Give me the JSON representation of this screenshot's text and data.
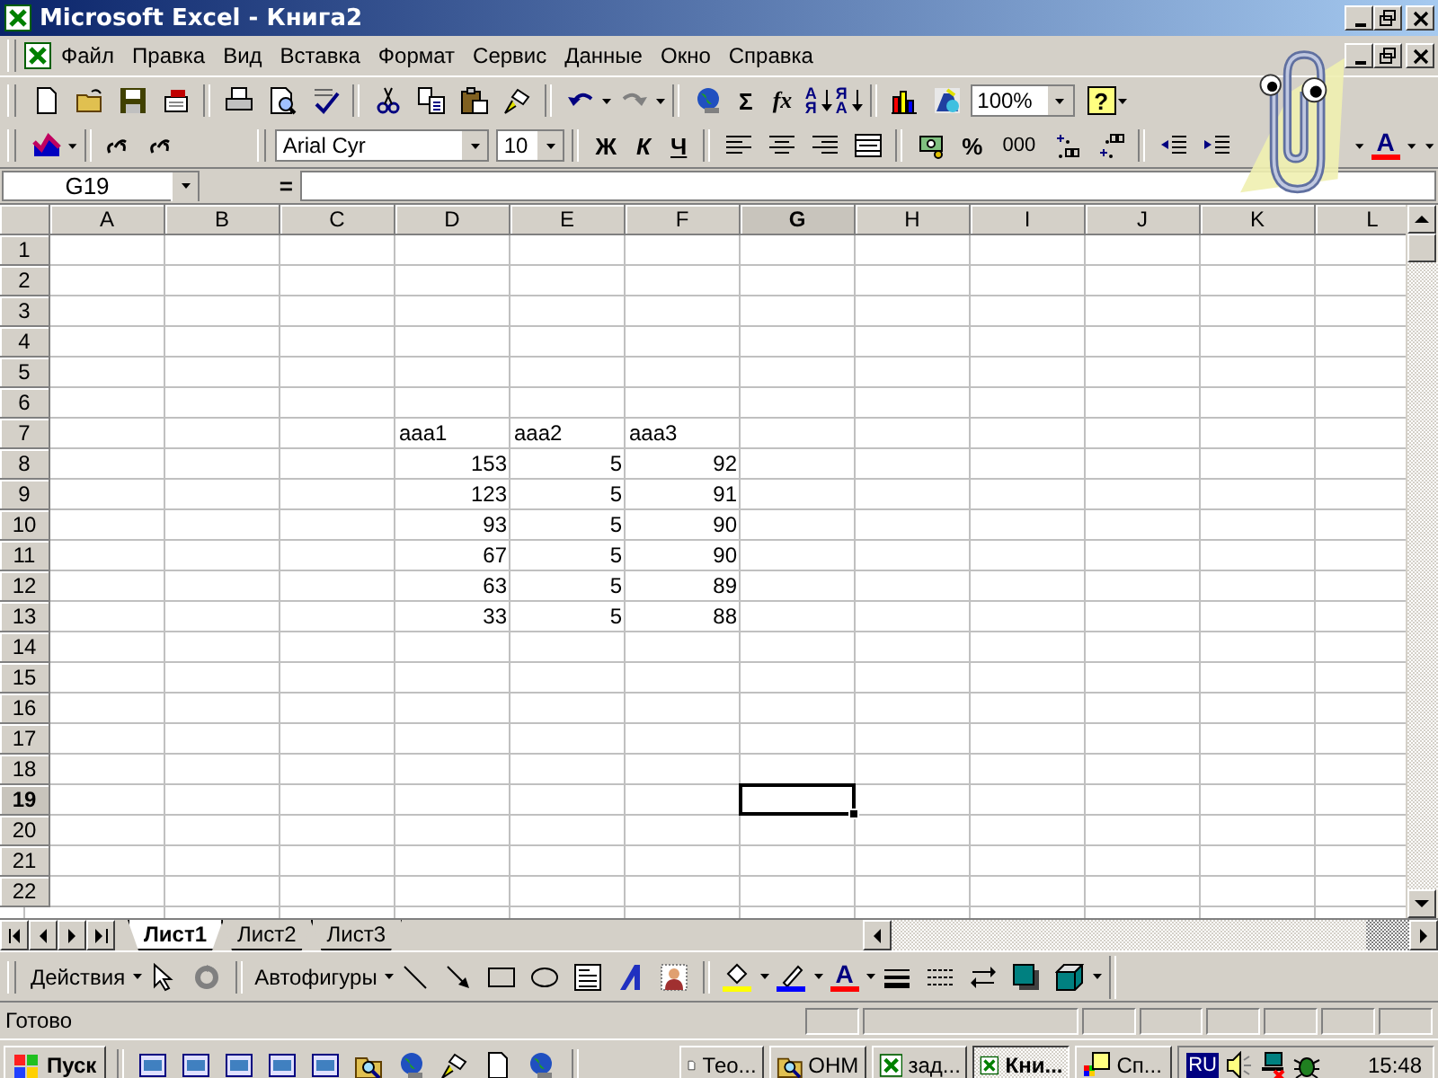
{
  "window": {
    "title": "Microsoft Excel - Книга2"
  },
  "menu": [
    "Файл",
    "Правка",
    "Вид",
    "Вставка",
    "Формат",
    "Сервис",
    "Данные",
    "Окно",
    "Справка"
  ],
  "standard_toolbar": {
    "sum": "Σ",
    "function": "fx",
    "sort_buttons": [
      "АЯ",
      "ЯА"
    ],
    "zoom": "100%",
    "help": "?"
  },
  "formatting_toolbar": {
    "font": "Arial Cyr",
    "size": "10",
    "style_buttons": [
      "Ж",
      "К",
      "Ч"
    ],
    "number_buttons": [
      "%",
      "000"
    ],
    "font_color": "A"
  },
  "formula_bar": {
    "name_box": "G19",
    "equals": "="
  },
  "grid": {
    "columns": [
      {
        "label": "A",
        "selected": false
      },
      {
        "label": "B",
        "selected": false
      },
      {
        "label": "C",
        "selected": false
      },
      {
        "label": "D",
        "selected": false
      },
      {
        "label": "E",
        "selected": false
      },
      {
        "label": "F",
        "selected": false
      },
      {
        "label": "G",
        "selected": true
      },
      {
        "label": "H",
        "selected": false
      },
      {
        "label": "I",
        "selected": false
      },
      {
        "label": "J",
        "selected": false
      },
      {
        "label": "K",
        "selected": false
      },
      {
        "label": "L",
        "selected": false
      }
    ],
    "rows": [
      {
        "label": "1",
        "selected": false
      },
      {
        "label": "2",
        "selected": false
      },
      {
        "label": "3",
        "selected": false
      },
      {
        "label": "4",
        "selected": false
      },
      {
        "label": "5",
        "selected": false
      },
      {
        "label": "6",
        "selected": false
      },
      {
        "label": "7",
        "selected": false,
        "cells": [
          {
            "kind": "text",
            "text": "aaa1"
          },
          {
            "kind": "text",
            "text": "aaa2"
          },
          {
            "kind": "text",
            "text": "aaa3"
          }
        ]
      },
      {
        "label": "8",
        "selected": false,
        "cells": [
          {
            "kind": "number",
            "text": "153"
          },
          {
            "kind": "number",
            "text": "5"
          },
          {
            "kind": "number",
            "text": "92"
          }
        ]
      },
      {
        "label": "9",
        "selected": false,
        "cells": [
          {
            "kind": "number",
            "text": "123"
          },
          {
            "kind": "number",
            "text": "5"
          },
          {
            "kind": "number",
            "text": "91"
          }
        ]
      },
      {
        "label": "10",
        "selected": false,
        "cells": [
          {
            "kind": "number",
            "text": "93"
          },
          {
            "kind": "number",
            "text": "5"
          },
          {
            "kind": "number",
            "text": "90"
          }
        ]
      },
      {
        "label": "11",
        "selected": false,
        "cells": [
          {
            "kind": "number",
            "text": "67"
          },
          {
            "kind": "number",
            "text": "5"
          },
          {
            "kind": "number",
            "text": "90"
          }
        ]
      },
      {
        "label": "12",
        "selected": false,
        "cells": [
          {
            "kind": "number",
            "text": "63"
          },
          {
            "kind": "number",
            "text": "5"
          },
          {
            "kind": "number",
            "text": "89"
          }
        ]
      },
      {
        "label": "13",
        "selected": false,
        "cells": [
          {
            "kind": "number",
            "text": "33"
          },
          {
            "kind": "number",
            "text": "5"
          },
          {
            "kind": "number",
            "text": "88"
          }
        ]
      },
      {
        "label": "14",
        "selected": false
      },
      {
        "label": "15",
        "selected": false
      },
      {
        "label": "16",
        "selected": false
      },
      {
        "label": "17",
        "selected": false
      },
      {
        "label": "18",
        "selected": false
      },
      {
        "label": "19",
        "selected": true
      },
      {
        "label": "20",
        "selected": false
      },
      {
        "label": "21",
        "selected": false
      },
      {
        "label": "22",
        "selected": false
      }
    ]
  },
  "sheet_tabs": [
    {
      "label": "Лист1",
      "selected": true
    },
    {
      "label": "Лист2",
      "selected": false
    },
    {
      "label": "Лист3",
      "selected": false
    }
  ],
  "drawing_toolbar": {
    "actions": "Действия",
    "autoshapes": "Автофигуры",
    "font_color": "A"
  },
  "status_bar": {
    "text": "Готово"
  },
  "taskbar": {
    "start": "Пуск",
    "tasks": [
      {
        "label": "Тео...",
        "selected": false
      },
      {
        "label": "ОНМ",
        "selected": false
      },
      {
        "label": "зад...",
        "selected": false
      },
      {
        "label": "Кни...",
        "selected": true
      },
      {
        "label": "Сп...",
        "selected": false
      }
    ],
    "language": "RU",
    "clock": "15:48"
  }
}
